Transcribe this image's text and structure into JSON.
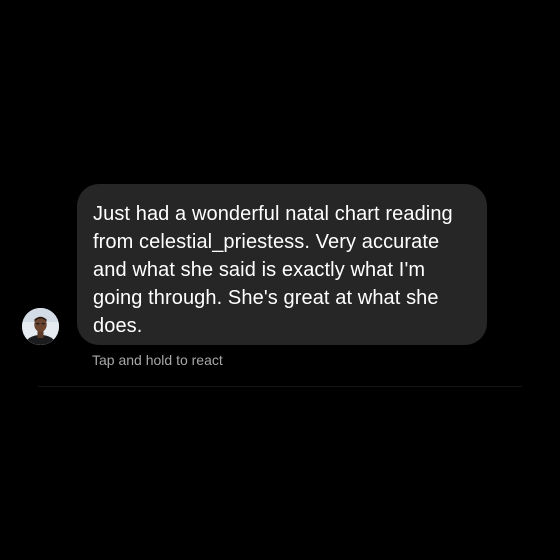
{
  "message": {
    "text": "Just had a wonderful natal chart reading from celestial_priestess. Very accurate and what she said is exactly what I'm going through. She's great at what she does.",
    "hint": "Tap and hold to react"
  },
  "sender": {
    "avatar_icon": "user-avatar"
  },
  "colors": {
    "background": "#000000",
    "bubble": "#262626",
    "text": "#ffffff",
    "hint": "#a8a8a8"
  }
}
